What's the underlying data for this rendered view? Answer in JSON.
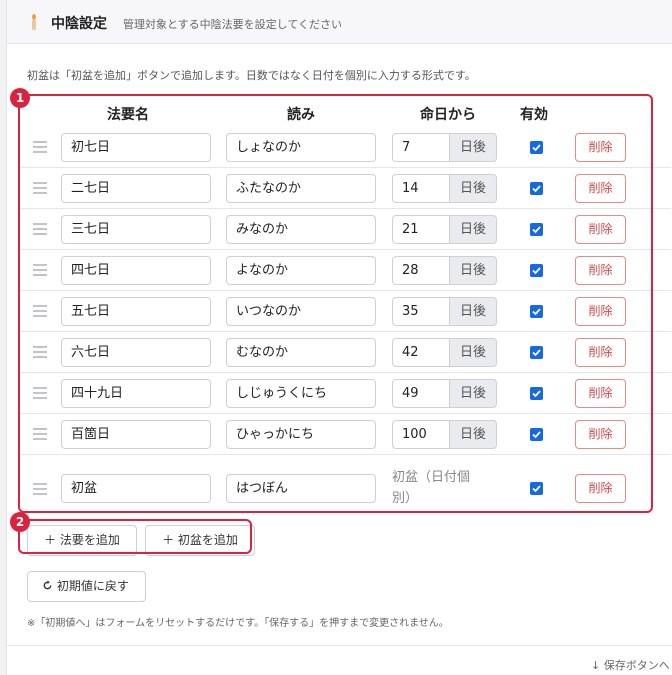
{
  "header": {
    "title": "中陰設定",
    "subtitle": "管理対象とする中陰法要を設定してください"
  },
  "description": "初盆は「初盆を追加」ボタンで追加します。日数ではなく日付を個別に入力する形式です。",
  "table": {
    "columns": [
      "法要名",
      "読み",
      "命日から",
      "有効"
    ],
    "day_suffix": "日後",
    "delete_label": "削除",
    "rows": [
      {
        "name": "初七日",
        "yomi": "しょなのか",
        "days": "7",
        "enabled": true
      },
      {
        "name": "二七日",
        "yomi": "ふたなのか",
        "days": "14",
        "enabled": true
      },
      {
        "name": "三七日",
        "yomi": "みなのか",
        "days": "21",
        "enabled": true
      },
      {
        "name": "四七日",
        "yomi": "よなのか",
        "days": "28",
        "enabled": true
      },
      {
        "name": "五七日",
        "yomi": "いつなのか",
        "days": "35",
        "enabled": true
      },
      {
        "name": "六七日",
        "yomi": "むなのか",
        "days": "42",
        "enabled": true
      },
      {
        "name": "四十九日",
        "yomi": "しじゅうくにち",
        "days": "49",
        "enabled": true
      },
      {
        "name": "百箇日",
        "yomi": "ひゃっかにち",
        "days": "100",
        "enabled": true
      }
    ],
    "hatsubon": {
      "name": "初盆",
      "yomi": "はつぼん",
      "note_line1": "初盆（日付個",
      "note_line2": "別）",
      "enabled": true
    }
  },
  "annotations": {
    "badge1": "1",
    "badge2": "2",
    "color": "#d9243f"
  },
  "buttons": {
    "add_houyou": "＋ 法要を追加",
    "add_hatsubon": "＋ 初盆を追加",
    "reset": "初期値に戻す"
  },
  "footnote": "※「初期値へ」はフォームをリセットするだけです。「保存する」を押すまで変更されません。",
  "save_link": "↓ 保存ボタンへ",
  "colors": {
    "accent": "#1769e0",
    "danger": "#d24a4a"
  }
}
